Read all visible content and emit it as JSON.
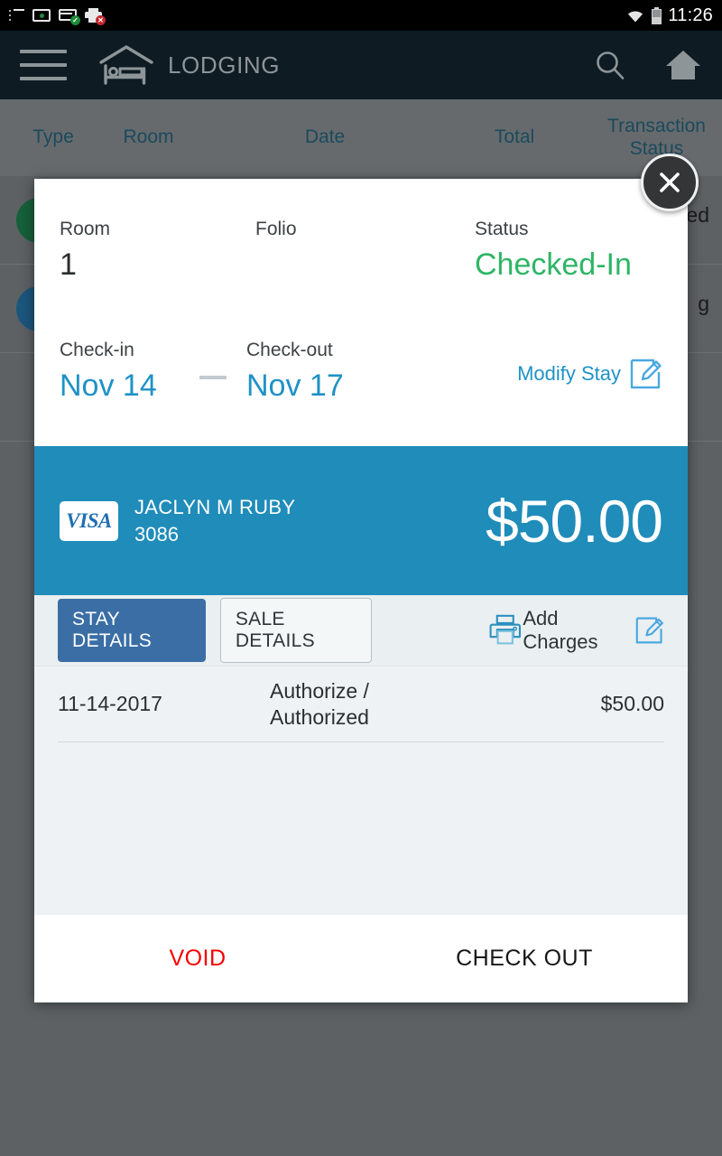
{
  "statusbar": {
    "clock": "11:26",
    "icons": [
      {
        "name": "list-icon"
      },
      {
        "name": "terminal-icon"
      },
      {
        "name": "card-reader-connected-icon",
        "badge": "✓"
      },
      {
        "name": "printer-error-icon",
        "badge": "✕"
      },
      {
        "name": "wifi-icon"
      },
      {
        "name": "battery-icon"
      }
    ]
  },
  "toolbar": {
    "title": "LODGING",
    "menu_icon": "hamburger-menu-icon",
    "brand_icon": "lodging-bed-icon",
    "search_icon": "search-icon",
    "home_icon": "home-icon"
  },
  "background_list": {
    "columns": [
      "Type",
      "Room",
      "Date",
      "Total",
      "Transaction Status"
    ],
    "rows": [
      {
        "dot_color": "#16603a",
        "tail_text": "ed"
      },
      {
        "dot_color": "#1b567d",
        "tail_text": "g"
      }
    ]
  },
  "modal": {
    "close_label": "✕",
    "stay": {
      "room_label": "Room",
      "room_value": "1",
      "folio_label": "Folio",
      "folio_value": "",
      "status_label": "Status",
      "status_value": "Checked-In",
      "checkin_label": "Check-in",
      "checkin_value": "Nov 14",
      "checkout_label": "Check-out",
      "checkout_value": "Nov 17",
      "modify_label": "Modify Stay",
      "modify_icon": "edit-pencil-icon"
    },
    "payment": {
      "card_brand": "VISA",
      "cardholder": "JACLYN M RUBY",
      "last4": "3086",
      "amount": "$50.00"
    },
    "actions": {
      "tab_stay": "STAY DETAILS",
      "tab_sale": "SALE DETAILS",
      "print_icon": "printer-icon",
      "add_charges_label": "Add Charges",
      "add_charges_icon": "edit-pencil-icon"
    },
    "transactions": {
      "rows": [
        {
          "date": "11-14-2017",
          "description": "Authorize /\nAuthorized",
          "amount": "$50.00"
        }
      ]
    },
    "footer": {
      "void_label": "VOID",
      "checkout_label": "CHECK OUT"
    }
  },
  "colors": {
    "accent_blue": "#1f92c6",
    "band_blue": "#1f8cba",
    "status_green": "#2eb565",
    "void_red": "#f50000",
    "tab_active": "#3a6ea5",
    "toolbar_dark": "#0e1b22",
    "scrim": "#5d6164"
  }
}
